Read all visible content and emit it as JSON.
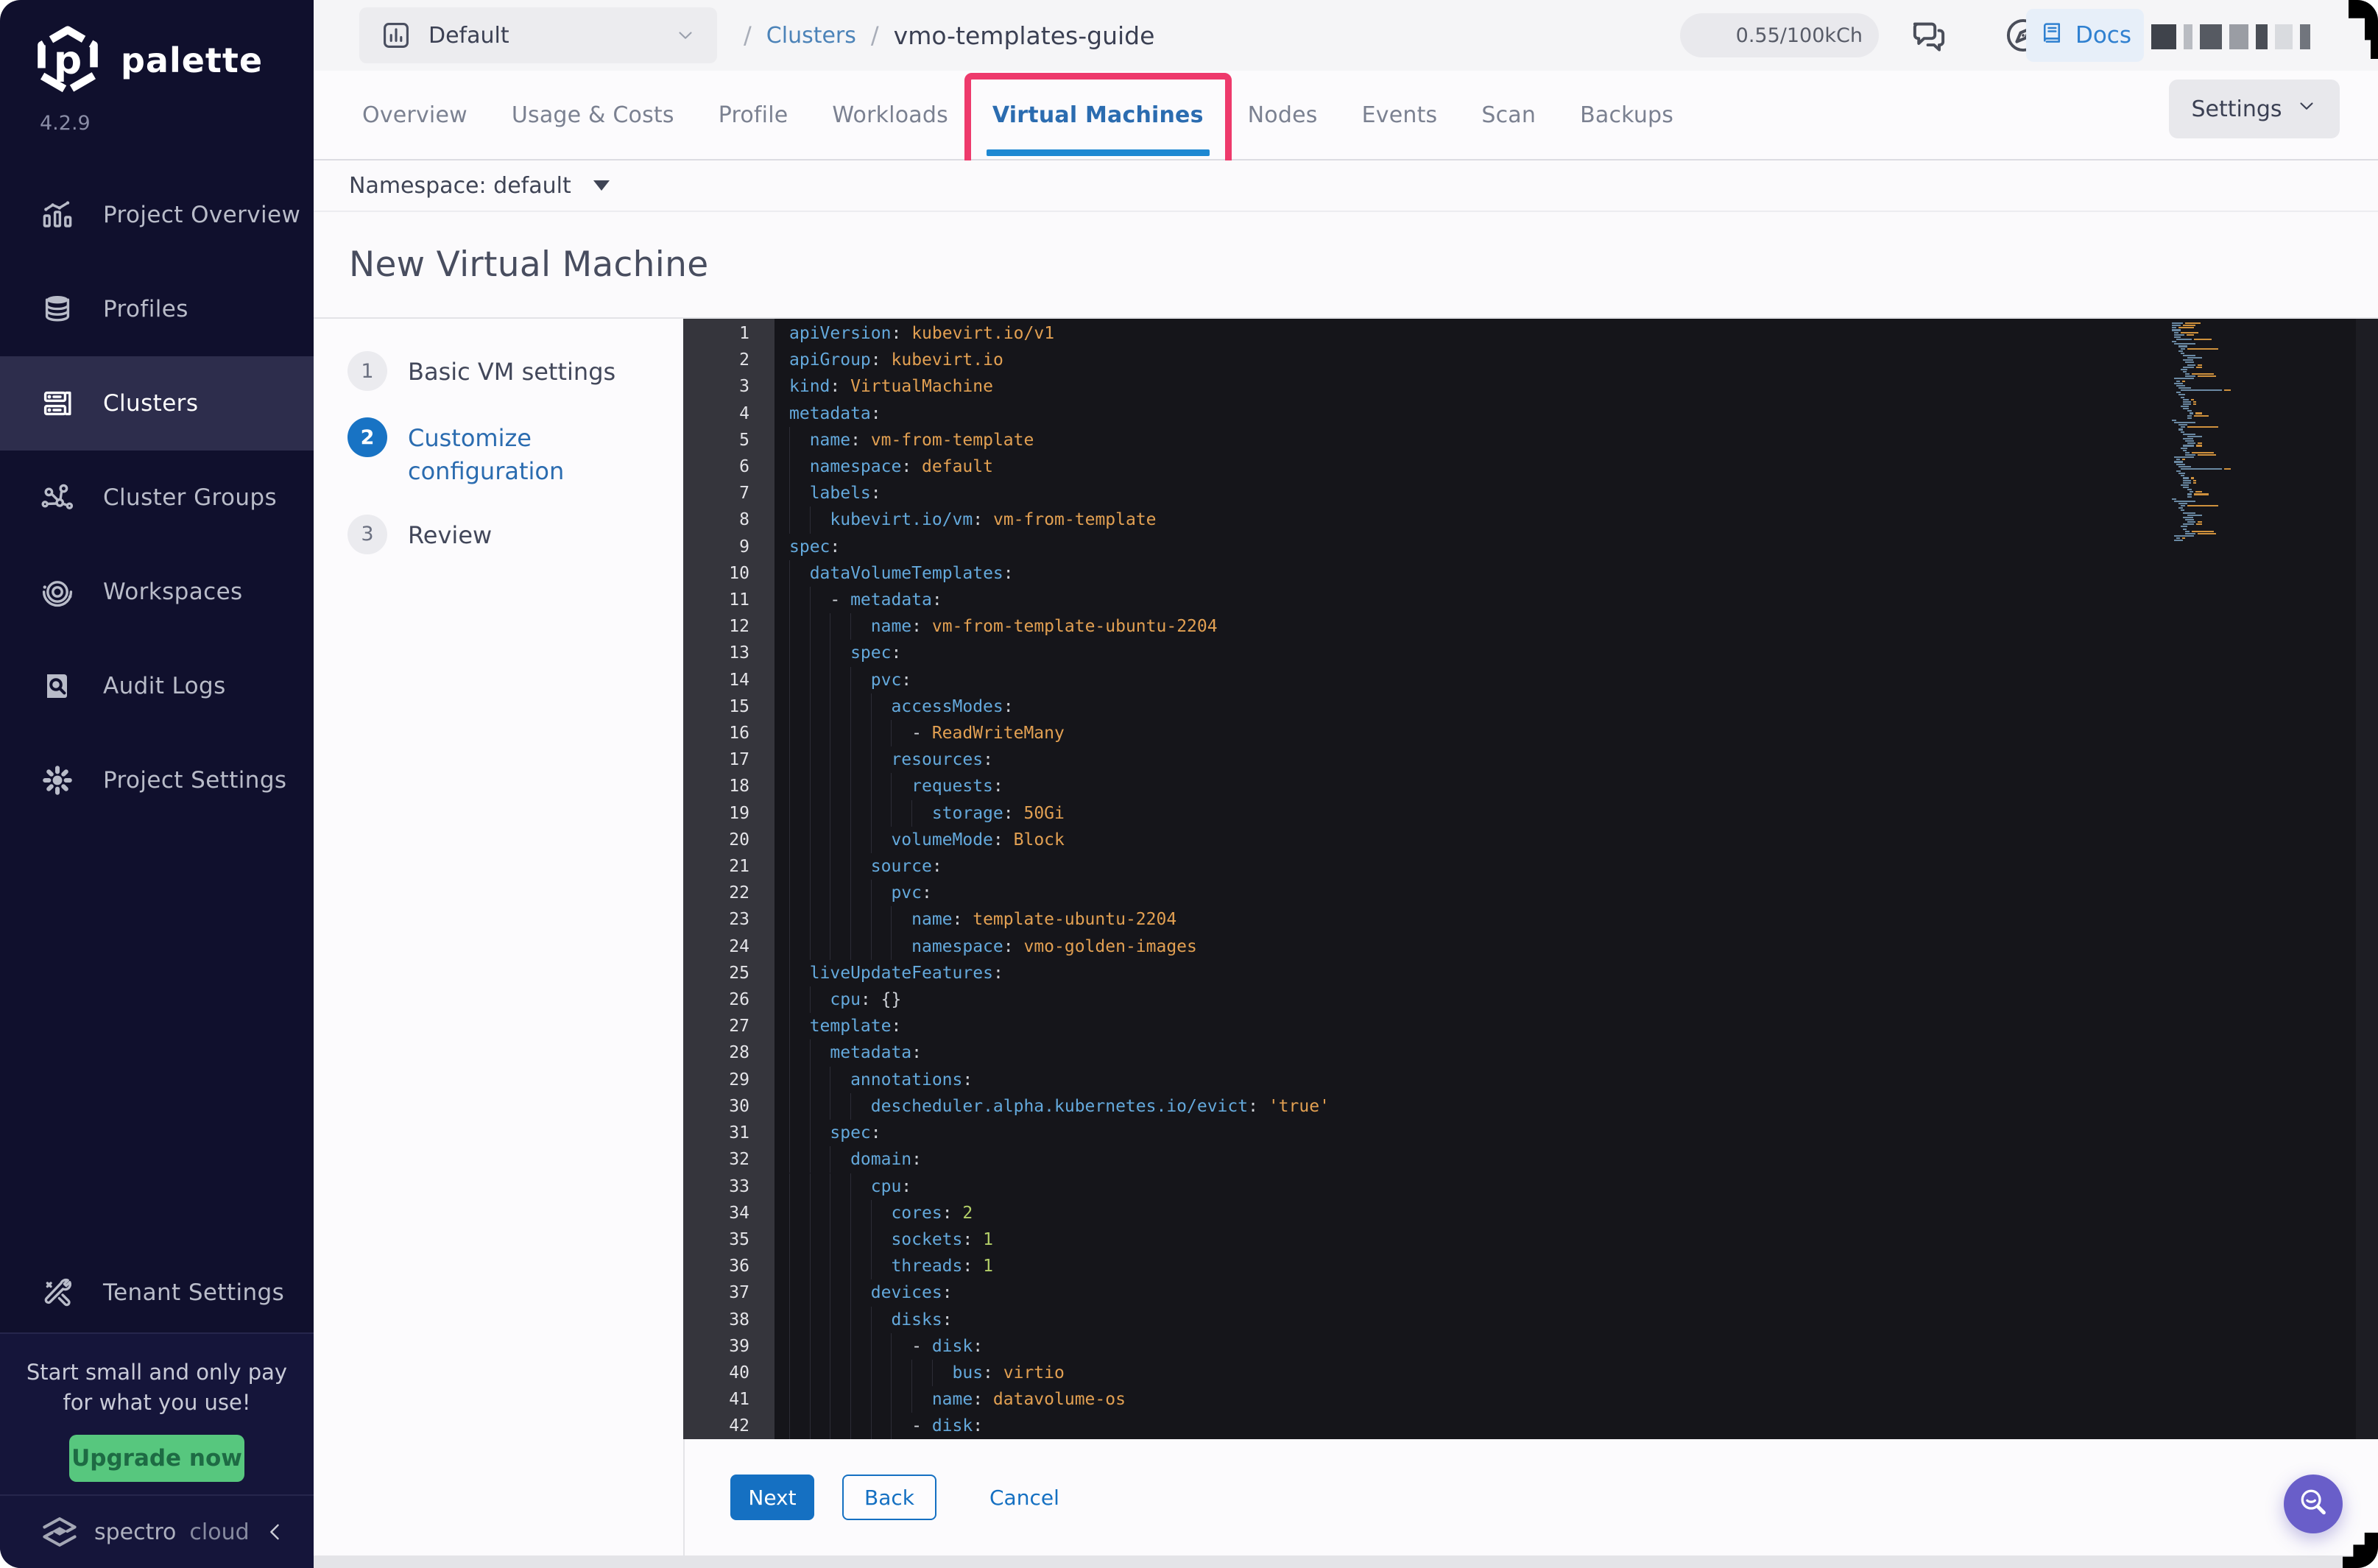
{
  "app": {
    "brand": "palette",
    "version": "4.2.9"
  },
  "sidebar": {
    "active": "Clusters",
    "items": [
      {
        "label": "Project Overview",
        "icon": "chart"
      },
      {
        "label": "Profiles",
        "icon": "layers"
      },
      {
        "label": "Clusters",
        "icon": "server"
      },
      {
        "label": "Cluster Groups",
        "icon": "network"
      },
      {
        "label": "Workspaces",
        "icon": "orbit"
      },
      {
        "label": "Audit Logs",
        "icon": "audit"
      },
      {
        "label": "Project Settings",
        "icon": "gear"
      }
    ],
    "tenant_label": "Tenant Settings",
    "promo": {
      "line1": "Start small and only pay",
      "line2": "for what you use!",
      "button": "Upgrade now"
    },
    "footer": {
      "brand_primary": "spectro",
      "brand_secondary": "cloud"
    }
  },
  "topbar": {
    "project": "Default",
    "separator": "/",
    "crumb_parent": "Clusters",
    "crumb_current": "vmo-templates-guide",
    "usage": "0.55/100kCh",
    "docs_label": "Docs"
  },
  "tabs": {
    "active": "Virtual Machines",
    "items": [
      "Overview",
      "Usage & Costs",
      "Profile",
      "Workloads",
      "Virtual Machines",
      "Nodes",
      "Events",
      "Scan",
      "Backups"
    ],
    "settings_label": "Settings"
  },
  "toolbar": {
    "namespace_label": "Namespace: default"
  },
  "page": {
    "title": "New Virtual Machine"
  },
  "wizard": {
    "active_index": 1,
    "steps": [
      "Basic VM settings",
      "Customize configuration",
      "Review"
    ]
  },
  "editor": {
    "language": "yaml",
    "lines": [
      "apiVersion: kubevirt.io/v1",
      "apiGroup: kubevirt.io",
      "kind: VirtualMachine",
      "metadata:",
      "  name: vm-from-template",
      "  namespace: default",
      "  labels:",
      "    kubevirt.io/vm: vm-from-template",
      "spec:",
      "  dataVolumeTemplates:",
      "    - metadata:",
      "        name: vm-from-template-ubuntu-2204",
      "      spec:",
      "        pvc:",
      "          accessModes:",
      "            - ReadWriteMany",
      "          resources:",
      "            requests:",
      "              storage: 50Gi",
      "          volumeMode: Block",
      "        source:",
      "          pvc:",
      "            name: template-ubuntu-2204",
      "            namespace: vmo-golden-images",
      "  liveUpdateFeatures:",
      "    cpu: {}",
      "  template:",
      "    metadata:",
      "      annotations:",
      "        descheduler.alpha.kubernetes.io/evict: 'true'",
      "    spec:",
      "      domain:",
      "        cpu:",
      "          cores: 2",
      "          sockets: 1",
      "          threads: 1",
      "        devices:",
      "          disks:",
      "            - disk:",
      "                bus: virtio",
      "              name: datavolume-os",
      "            - disk:"
    ]
  },
  "footer": {
    "next_label": "Next",
    "back_label": "Back",
    "cancel_label": "Cancel"
  },
  "colors": {
    "accent_blue": "#1570c2",
    "tab_active_blue": "#2b6cb0",
    "annotation_pink": "#ee3a6c",
    "upgrade_green": "#57c77e",
    "sidebar_bg": "#10102d",
    "editor_bg": "#15151a",
    "yaml_key": "#64a9dc",
    "yaml_value": "#e2a052",
    "yaml_number": "#b3cf68",
    "fab_purple": "#695ec9"
  }
}
